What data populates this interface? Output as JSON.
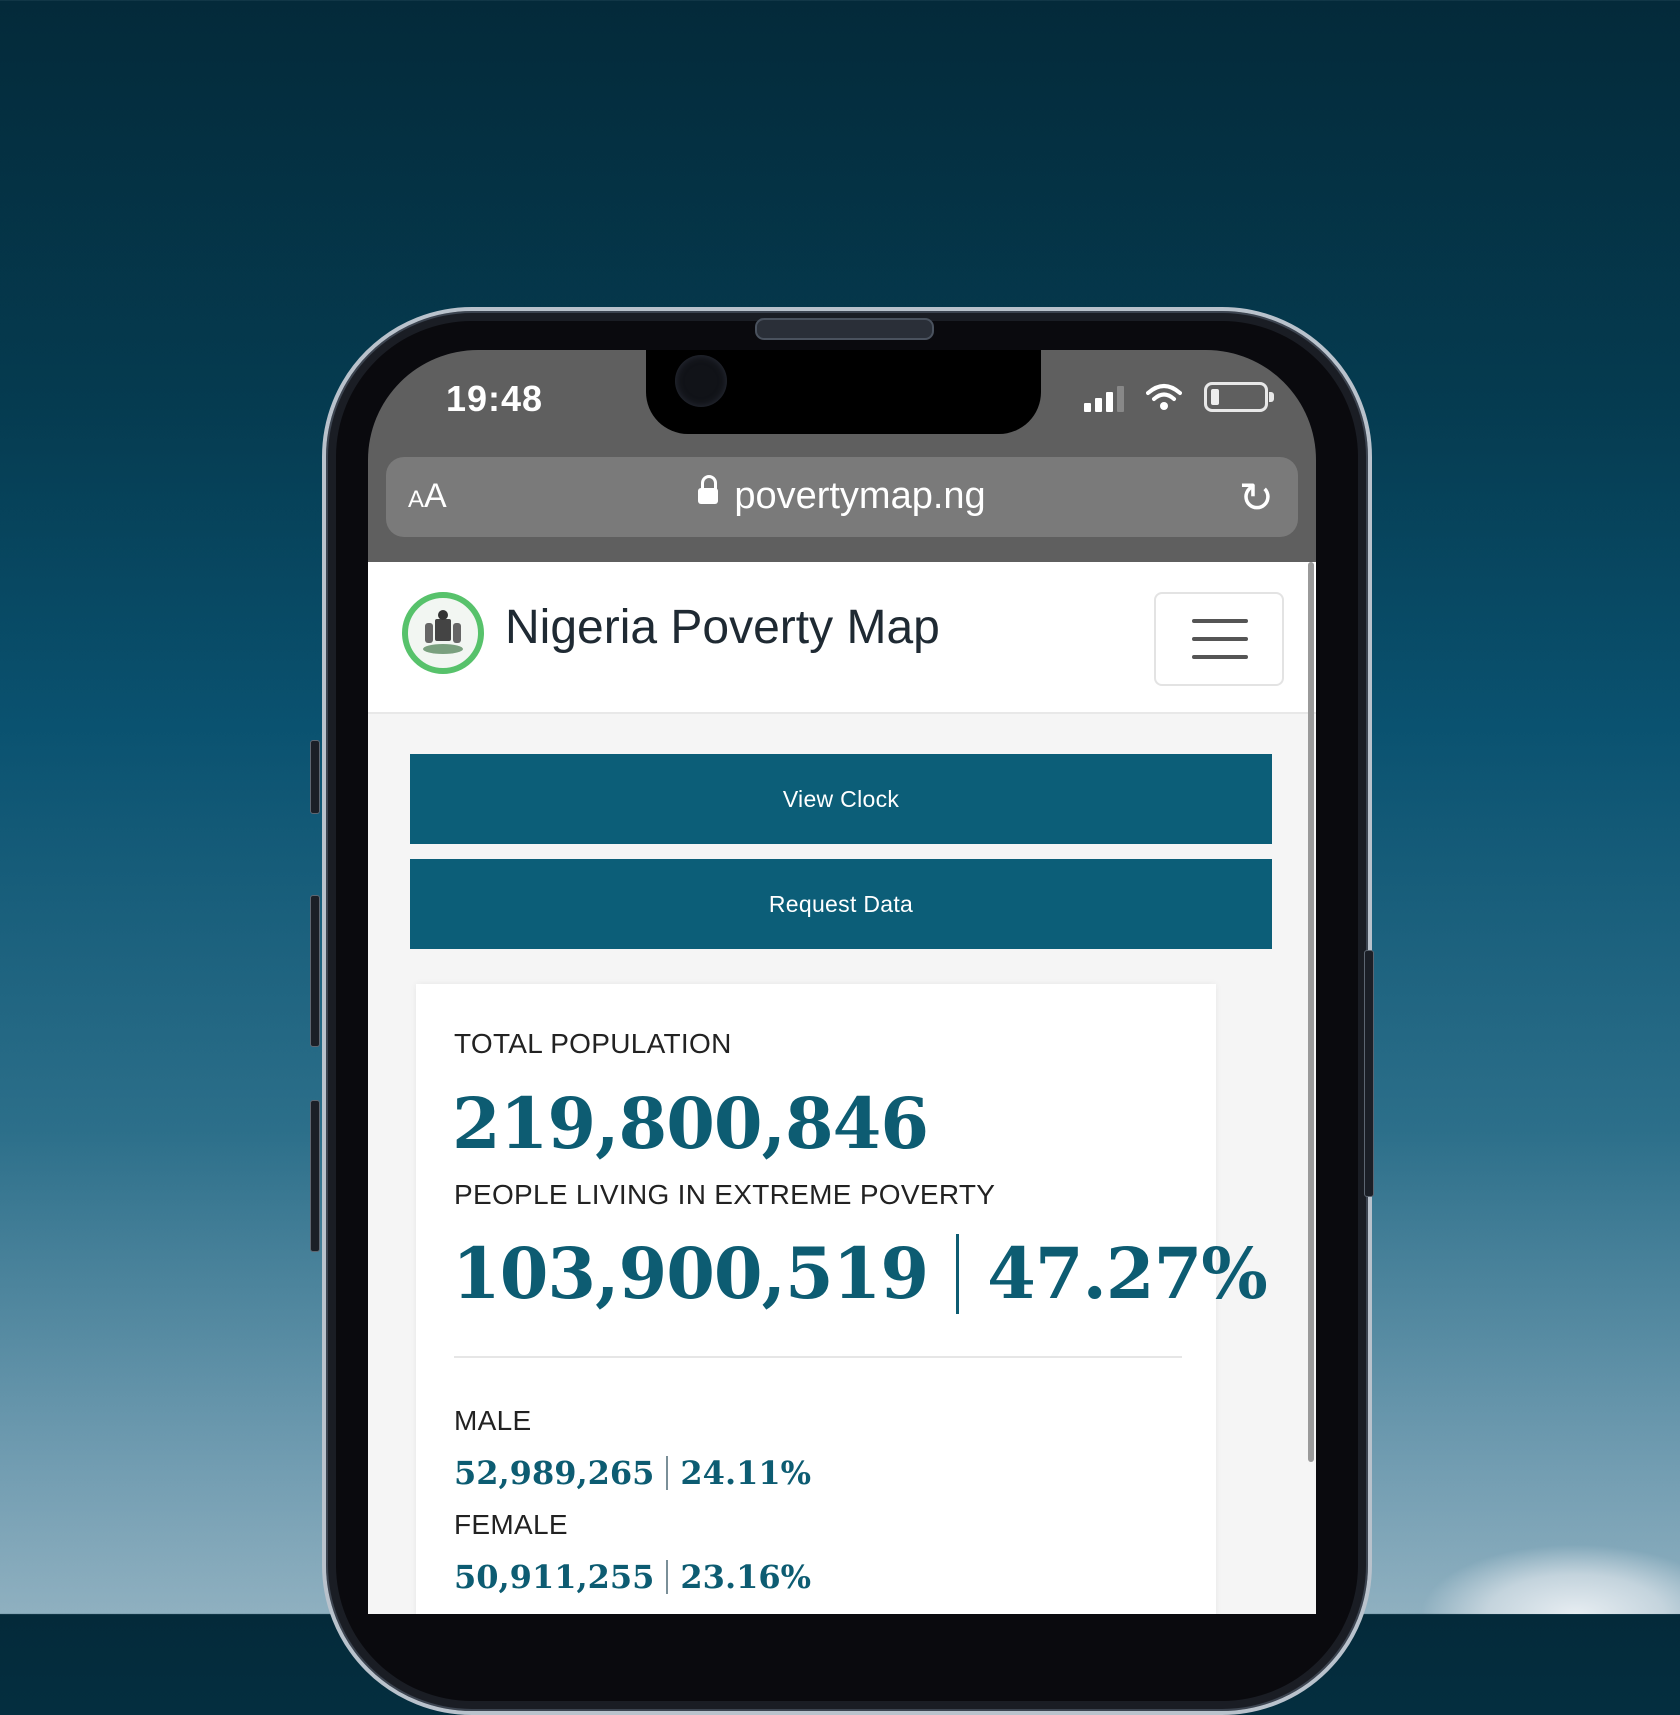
{
  "status": {
    "time": "19:48"
  },
  "browser": {
    "text_size_small": "A",
    "text_size_large": "A",
    "url": "povertymap.ng"
  },
  "site": {
    "brand": "Nigeria Poverty Map"
  },
  "buttons": {
    "view_clock": "View Clock",
    "request_data": "Request Data"
  },
  "stats": {
    "total_population_label": "TOTAL POPULATION",
    "total_population": "219,800,846",
    "extreme_poverty_label": "PEOPLE LIVING IN EXTREME POVERTY",
    "extreme_poverty_count": "103,900,519",
    "extreme_poverty_pct": "47.27%",
    "male_label": "MALE",
    "male_count": "52,989,265",
    "male_pct": "24.11%",
    "female_label": "FEMALE",
    "female_count": "50,911,255",
    "female_pct": "23.16%"
  },
  "colors": {
    "accent": "#0c5e78",
    "logo_ring": "#57c26b"
  }
}
